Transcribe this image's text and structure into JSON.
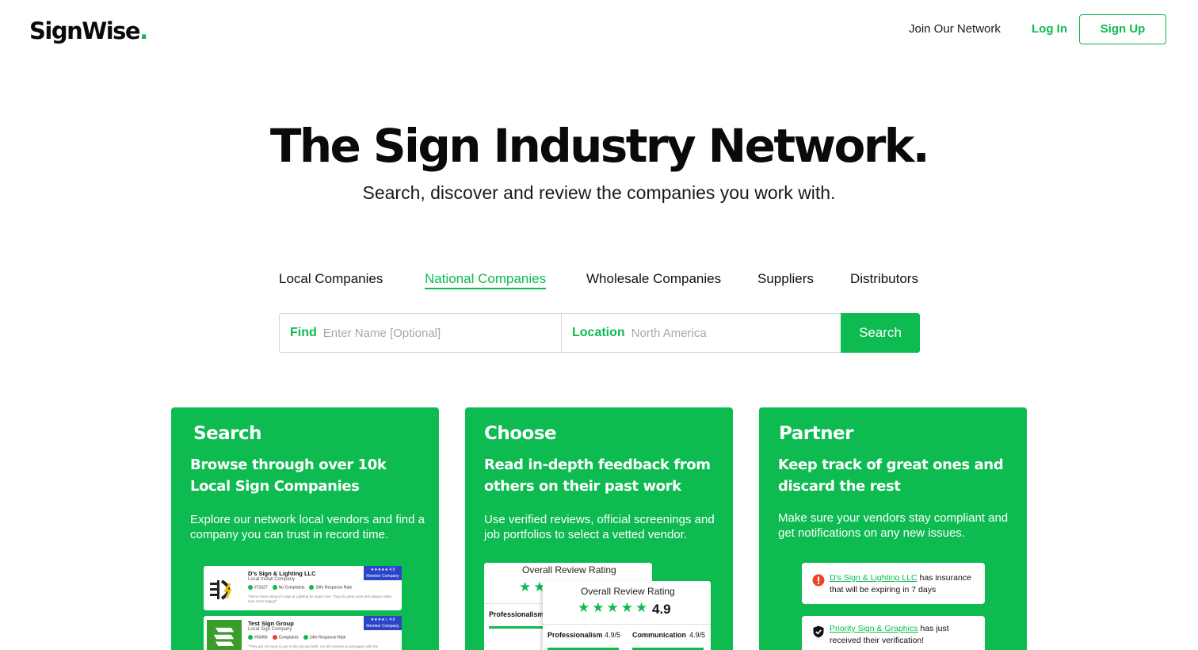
{
  "header": {
    "logo_text": "SignWise",
    "logo_dot": ".",
    "join_label": "Join Our Network",
    "login_label": "Log In",
    "signup_label": "Sign Up"
  },
  "hero": {
    "title": "The Sign Industry Network.",
    "subtitle": "Search, discover and review the companies you work with."
  },
  "tabs": [
    {
      "label": "Local Companies",
      "active": false
    },
    {
      "label": "National Companies",
      "active": true
    },
    {
      "label": "Wholesale Companies",
      "active": false
    },
    {
      "label": "Suppliers",
      "active": false
    },
    {
      "label": "Distributors",
      "active": false
    }
  ],
  "search": {
    "find_label": "Find",
    "find_placeholder": "Enter Name [Optional]",
    "location_label": "Location",
    "location_placeholder": "North America",
    "button_label": "Search"
  },
  "cards": [
    {
      "title": "Search",
      "heading": "Browse through over 10k Local Sign Companies",
      "description": "Explore our network local vendors and find a company you can trust in record time.",
      "listings": [
        {
          "name": "D's Sign & Lighting LLC",
          "type": "Local Install Company",
          "badge_rating": "★★★★★ 4.9",
          "badge_label": "Member Company",
          "stat1": "#71627",
          "stat2": "No Complaints",
          "stat3": "24hr Response Rate",
          "quote": "\"We've been using D's Sign & Lighting for years now. They do great work and always make sure we're happy!\""
        },
        {
          "name": "Test Sign Group",
          "type": "Local Sign Company",
          "badge_rating": "★★★★☆ 4.6",
          "badge_label": "Member Company",
          "stat1": "#93456",
          "stat2": "Complaints",
          "stat3": "24hr Response Rate",
          "quote": "\"They are SO easy to get to the job and with. I've left reviews & messages with the"
        }
      ]
    },
    {
      "title": "Choose",
      "heading": "Read in-depth feedback from others on their past work",
      "description": "Use verified reviews, official screenings and job portfolios to select a vetted vendor.",
      "review_back": {
        "title": "Overall Review Rating",
        "stars": "★★",
        "category": "Professionalism"
      },
      "review_front": {
        "title": "Overall Review Rating",
        "stars": "★★★★★",
        "rating": "4.9",
        "cat1": "Professionalism",
        "val1": "4.9/5",
        "cat2": "Communication",
        "val2": "4.9/5"
      }
    },
    {
      "title": "Partner",
      "heading": "Keep track of great ones and discard the rest",
      "description": "Make sure your vendors stay compliant and get notifications on any new issues.",
      "notifications": [
        {
          "link": "D's Sign & Lighting LLC",
          "text": " has insurance that will be expiring in 7 days"
        },
        {
          "link": "Priority Sign & Graphics",
          "text": " has just received their verification!"
        }
      ]
    }
  ],
  "colors": {
    "brand_green": "#0dbb50",
    "badge_blue": "#2b45c8",
    "alert_red": "#e8452c"
  }
}
